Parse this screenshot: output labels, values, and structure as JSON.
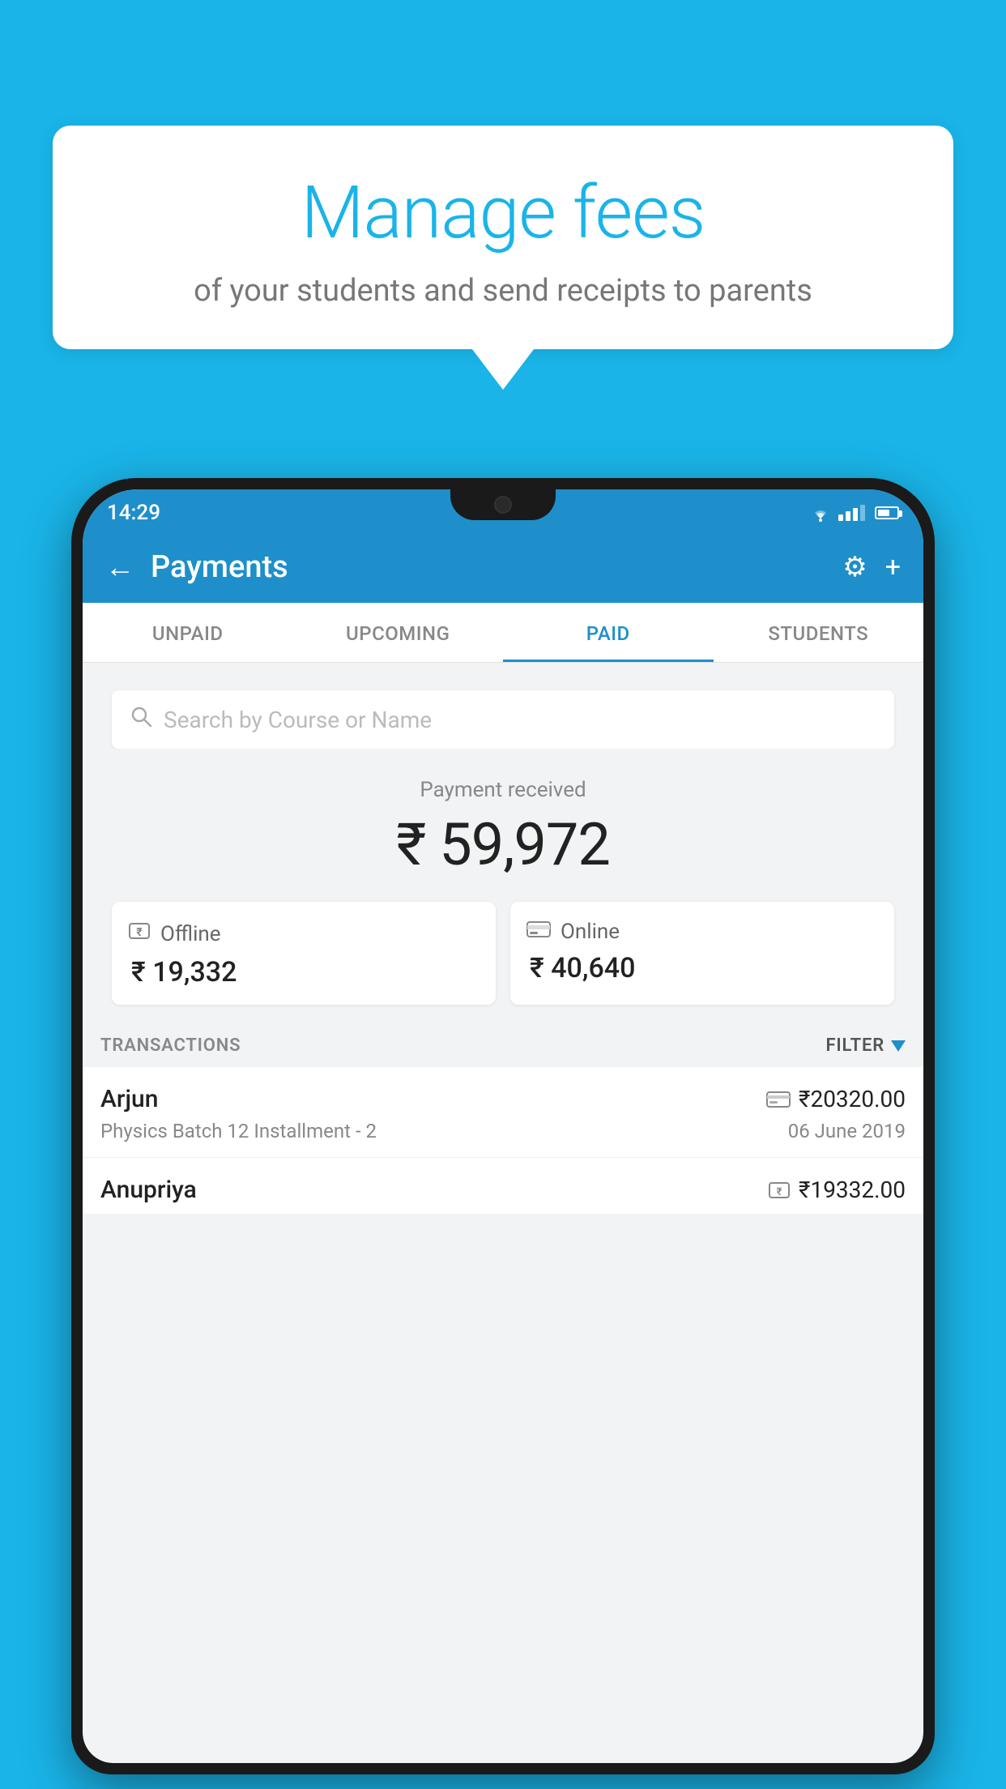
{
  "background_color": "#1ab4e8",
  "speech_bubble": {
    "title": "Manage fees",
    "subtitle": "of your students and send receipts to parents"
  },
  "status_bar": {
    "time": "14:29"
  },
  "header": {
    "title": "Payments",
    "back_label": "←",
    "gear_label": "⚙",
    "plus_label": "+"
  },
  "tabs": [
    {
      "label": "UNPAID",
      "active": false
    },
    {
      "label": "UPCOMING",
      "active": false
    },
    {
      "label": "PAID",
      "active": true
    },
    {
      "label": "STUDENTS",
      "active": false
    }
  ],
  "search": {
    "placeholder": "Search by Course or Name"
  },
  "payment_received": {
    "label": "Payment received",
    "amount": "₹ 59,972"
  },
  "payment_cards": [
    {
      "icon": "offline",
      "label": "Offline",
      "amount": "₹ 19,332"
    },
    {
      "icon": "online",
      "label": "Online",
      "amount": "₹ 40,640"
    }
  ],
  "transactions_section": {
    "label": "TRANSACTIONS",
    "filter_label": "FILTER"
  },
  "transactions": [
    {
      "name": "Arjun",
      "payment_type": "card",
      "amount": "₹20320.00",
      "course": "Physics Batch 12 Installment - 2",
      "date": "06 June 2019"
    },
    {
      "name": "Anupriya",
      "payment_type": "offline",
      "amount": "₹19332.00",
      "course": "",
      "date": ""
    }
  ]
}
